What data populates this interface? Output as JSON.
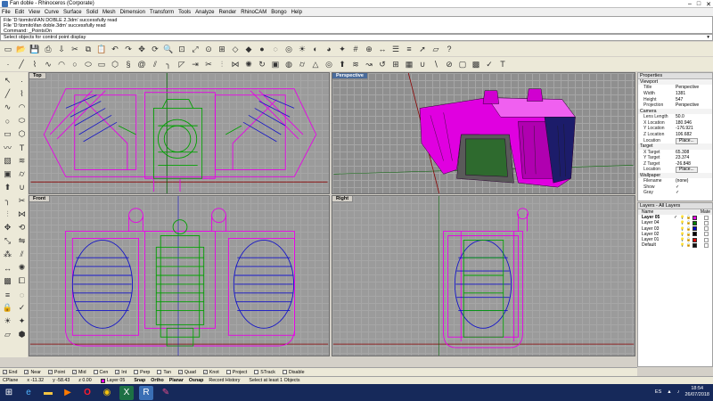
{
  "window": {
    "title": "Fan doble - Rhinoceros (Corporate)",
    "controls": [
      "–",
      "□",
      "✕"
    ]
  },
  "menu": [
    "File",
    "Edit",
    "View",
    "Curve",
    "Surface",
    "Solid",
    "Mesh",
    "Dimension",
    "Transform",
    "Tools",
    "Analyze",
    "Render",
    "RhinoCAM",
    "Bongo",
    "Help"
  ],
  "command_history": [
    "File 'D:\\tomito\\FAN DOBLE 2.3dm' successfully read",
    "File 'D:\\tomito\\fan doble.3dm' successfully read",
    "Command: _PointsOn"
  ],
  "command_prompt": "Select objects for control point display",
  "toolbar1_icons": [
    "new-icon",
    "open-icon",
    "save-icon",
    "print-icon",
    "import-icon",
    "cut-icon",
    "copy-icon",
    "paste-icon",
    "undo-icon",
    "redo-icon",
    "pan-icon",
    "rotate-view-icon",
    "zoom-icon",
    "zoom-window-icon",
    "zoom-extents-icon",
    "zoom-selected-icon",
    "four-view-icon",
    "wireframe-icon",
    "shaded-icon",
    "rendered-icon",
    "ghosted-icon",
    "xray-icon",
    "render-icon",
    "material-icon",
    "color-wheel-icon",
    "light-icon",
    "grid-icon",
    "osnap-icon",
    "dimension-icon",
    "properties-icon",
    "layer-icon",
    "select-icon",
    "cplane-icon",
    "help-icon"
  ],
  "toolbar2_icons": [
    "point-icon",
    "line-icon",
    "polyline-icon",
    "curve-icon",
    "arc-icon",
    "circle-icon",
    "ellipse-icon",
    "rectangle-icon",
    "polygon-icon",
    "helix-icon",
    "spiral-icon",
    "offset-icon",
    "fillet-icon",
    "chamfer-icon",
    "extend-icon",
    "trim-icon",
    "split-icon",
    "join-icon",
    "explode-icon",
    "rebuild-icon",
    "box-icon",
    "sphere-icon",
    "cylinder-icon",
    "cone-icon",
    "torus-icon",
    "extrude-icon",
    "loft-icon",
    "sweep-icon",
    "revolve-icon",
    "network-icon",
    "patch-icon",
    "boolean-union-icon",
    "boolean-diff-icon",
    "boolean-split-icon",
    "shell-icon",
    "mesh-icon",
    "analyze-icon",
    "text-icon"
  ],
  "left_toolbar_icons": [
    "select-arrow-icon",
    "point-icon",
    "line-icon",
    "polyline-icon",
    "curve-icon",
    "arc-icon",
    "circle-icon",
    "ellipse-icon",
    "rectangle-icon",
    "polygon-icon",
    "freeform-icon",
    "text-icon",
    "surface-icon",
    "loft-icon",
    "box-icon",
    "cylinder-icon",
    "extrude-icon",
    "boolean-icon",
    "fillet-icon",
    "trim-icon",
    "split-icon",
    "join-icon",
    "move-icon",
    "rotate-icon",
    "scale-icon",
    "mirror-icon",
    "array-icon",
    "offset-icon",
    "dimension-icon",
    "explode-icon",
    "mesh-icon",
    "group-icon",
    "layer-icon",
    "hide-icon",
    "lock-icon",
    "analyze-icon",
    "render-icon",
    "light-icon",
    "cplane-icon",
    "cube-icon"
  ],
  "viewports": {
    "top": "Top",
    "perspective": "Perspective",
    "front": "Front",
    "right": "Right"
  },
  "properties": {
    "header": "Properties",
    "viewport_section": "Viewport",
    "viewport_rows": [
      {
        "k": "Title",
        "v": "Perspective"
      },
      {
        "k": "Width",
        "v": "1381"
      },
      {
        "k": "Height",
        "v": "547"
      },
      {
        "k": "Projection",
        "v": "Perspective"
      }
    ],
    "camera_section": "Camera",
    "camera_rows": [
      {
        "k": "Lens Length",
        "v": "50.0"
      },
      {
        "k": "X Location",
        "v": "180.946"
      },
      {
        "k": "Y Location",
        "v": "-176.921"
      },
      {
        "k": "Z Location",
        "v": "106.682"
      }
    ],
    "location_label": "Location",
    "place_button": "Place...",
    "target_section": "Target",
    "target_rows": [
      {
        "k": "X Target",
        "v": "65.308"
      },
      {
        "k": "Y Target",
        "v": "23.374"
      },
      {
        "k": "Z Target",
        "v": "-26.848"
      }
    ],
    "target_location_label": "Location",
    "target_place_button": "Place...",
    "wallpaper_section": "Wallpaper",
    "wallpaper_rows": [
      {
        "k": "Filename",
        "v": "(none)"
      },
      {
        "k": "Show",
        "v": "✓"
      },
      {
        "k": "Gray",
        "v": "✓"
      }
    ]
  },
  "layers": {
    "header": "Layers - All Layers",
    "col_name": "Name",
    "col_mat": "Mate",
    "rows": [
      {
        "name": "Layer 05",
        "current": "✓",
        "color": "#e800e8",
        "bold": true
      },
      {
        "name": "Layer 04",
        "current": "",
        "color": "#008000",
        "bold": false
      },
      {
        "name": "Layer 03",
        "current": "",
        "color": "#0000c8",
        "bold": false
      },
      {
        "name": "Layer 02",
        "current": "",
        "color": "#000000",
        "bold": false
      },
      {
        "name": "Layer 01",
        "current": "",
        "color": "#e00000",
        "bold": false
      },
      {
        "name": "Default",
        "current": "",
        "color": "#111111",
        "bold": false
      }
    ]
  },
  "osnaps": [
    {
      "label": "End",
      "checked": true
    },
    {
      "label": "Near",
      "checked": true
    },
    {
      "label": "Point",
      "checked": true
    },
    {
      "label": "Mid",
      "checked": true
    },
    {
      "label": "Cen",
      "checked": false
    },
    {
      "label": "Int",
      "checked": true
    },
    {
      "label": "Perp",
      "checked": false
    },
    {
      "label": "Tan",
      "checked": false
    },
    {
      "label": "Quad",
      "checked": true
    },
    {
      "label": "Knot",
      "checked": true
    },
    {
      "label": "Project",
      "checked": false
    },
    {
      "label": "STrack",
      "checked": false
    },
    {
      "label": "Disable",
      "checked": false
    }
  ],
  "status": {
    "cplane": "CPlane",
    "x": "x -11.32",
    "y": "y -58.43",
    "z": "z 0.00",
    "layer": "Layer 05",
    "snap": "Snap",
    "ortho": "Ortho",
    "planar": "Planar",
    "osnap": "Osnap",
    "record_history": "Record History",
    "message": "Select at least 1 Objects"
  },
  "taskbar": {
    "apps": [
      "start-icon",
      "ie-icon",
      "folder-icon",
      "media-icon",
      "opera-icon",
      "chrome-icon",
      "excel-icon",
      "rhino-icon",
      "paint-icon"
    ],
    "lang": "ES",
    "time": "18:54",
    "date": "26/07/2018"
  },
  "colors": {
    "magenta": "#e800e8",
    "green": "#00a000",
    "blue": "#1414c8",
    "black": "#000000"
  }
}
